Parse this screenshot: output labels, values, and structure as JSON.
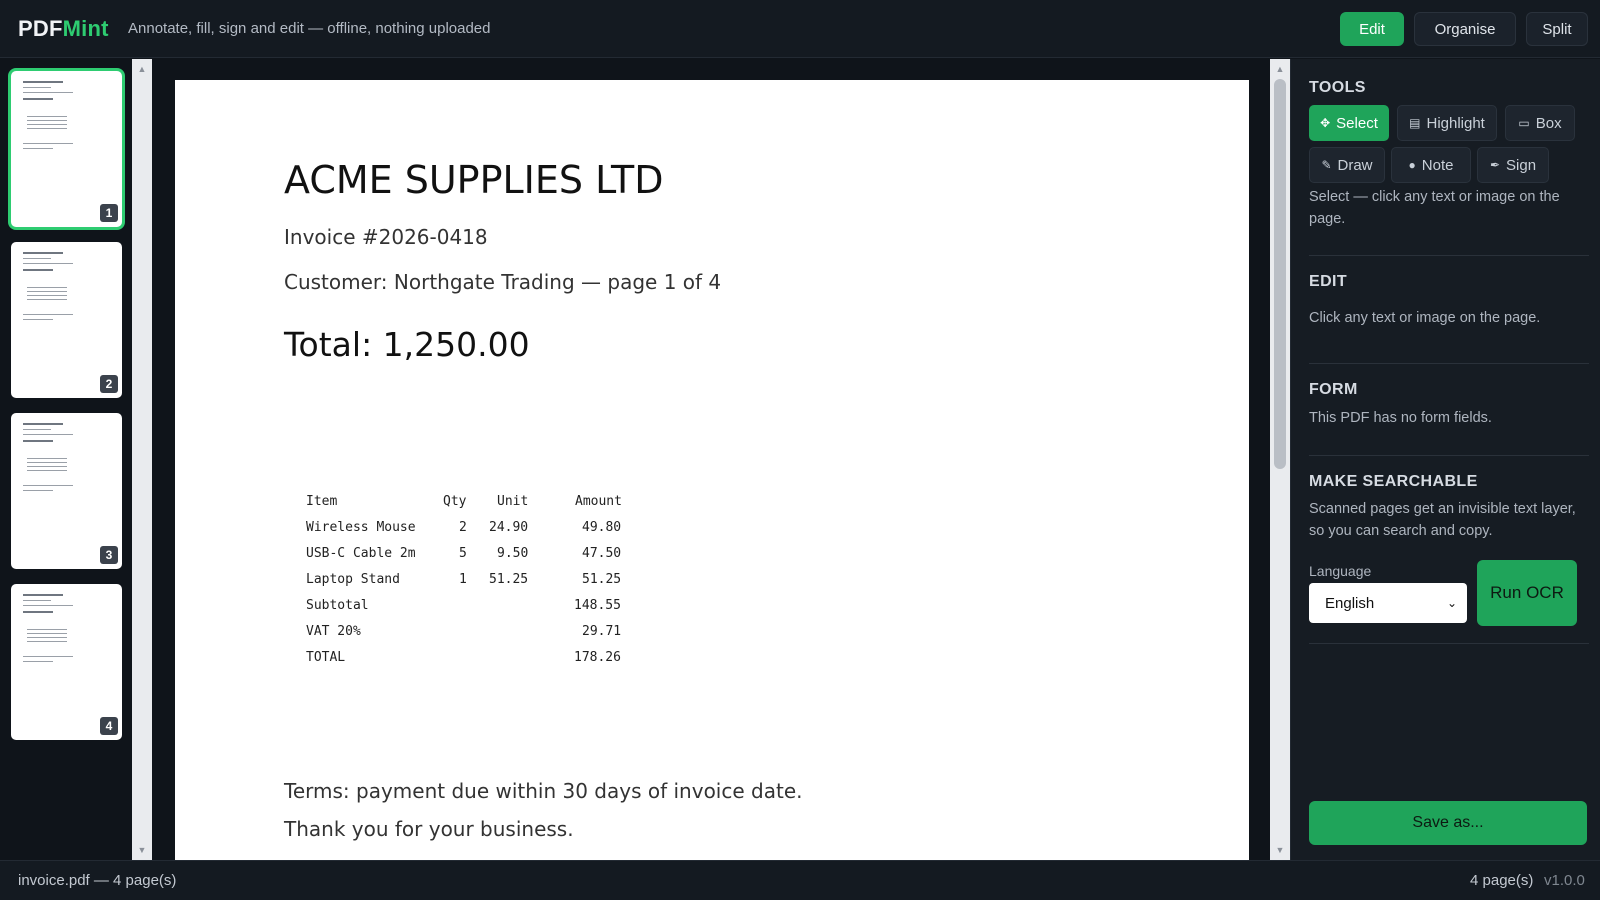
{
  "app": {
    "brand_part1": "PDF",
    "brand_part2": "Mint",
    "tagline": "Annotate, fill, sign and edit — offline, nothing uploaded",
    "accent_color": "#1fa45a"
  },
  "header": {
    "modes": [
      {
        "label": "Edit",
        "active": true
      },
      {
        "label": "Organise",
        "active": false
      },
      {
        "label": "Split",
        "active": false
      }
    ]
  },
  "thumbnails": [
    {
      "number": "1",
      "selected": true
    },
    {
      "number": "2",
      "selected": false
    },
    {
      "number": "3",
      "selected": false
    },
    {
      "number": "4",
      "selected": false
    }
  ],
  "document": {
    "title": "ACME SUPPLIES LTD",
    "invoice": "Invoice #2026-0418",
    "customer": "Customer: Northgate Trading — page 1 of 4",
    "total": "Total: 1,250.00",
    "table": {
      "headers": [
        "Item",
        "Qty",
        "Unit",
        "Amount"
      ],
      "rows": [
        [
          "Wireless Mouse",
          "2",
          "24.90",
          "49.80"
        ],
        [
          "USB-C Cable 2m",
          "5",
          "9.50",
          "47.50"
        ],
        [
          "Laptop Stand",
          "1",
          "51.25",
          "51.25"
        ],
        [
          "Subtotal",
          "",
          "",
          "148.55"
        ],
        [
          "VAT 20%",
          "",
          "",
          "29.71"
        ],
        [
          "TOTAL",
          "",
          "",
          "178.26"
        ]
      ]
    },
    "terms": "Terms: payment due within 30 days of invoice date.",
    "thanks": "Thank you for your business."
  },
  "panel": {
    "tools_title": "TOOLS",
    "tools": [
      {
        "label": "Select",
        "icon": "move-icon",
        "active": true
      },
      {
        "label": "Highlight",
        "icon": "highlight-icon",
        "active": false
      },
      {
        "label": "Box",
        "icon": "box-icon",
        "active": false
      },
      {
        "label": "Draw",
        "icon": "pencil-icon",
        "active": false
      },
      {
        "label": "Note",
        "icon": "note-icon",
        "active": false
      },
      {
        "label": "Sign",
        "icon": "sign-icon",
        "active": false
      }
    ],
    "tool_hint": "Select — click any text or image on the page.",
    "edit_title": "EDIT",
    "edit_text": "Click any text or image on the page.",
    "form_title": "FORM",
    "form_text": "This PDF has no form fields.",
    "searchable_title": "MAKE SEARCHABLE",
    "searchable_text": "Scanned pages get an invisible text layer, so you can search and copy.",
    "language_label": "Language",
    "language_value": "English",
    "ocr_button": "Run OCR",
    "save_button": "Save as..."
  },
  "status": {
    "left": "invoice.pdf — 4 page(s)",
    "pages": "4 page(s)",
    "version": "v1.0.0"
  }
}
